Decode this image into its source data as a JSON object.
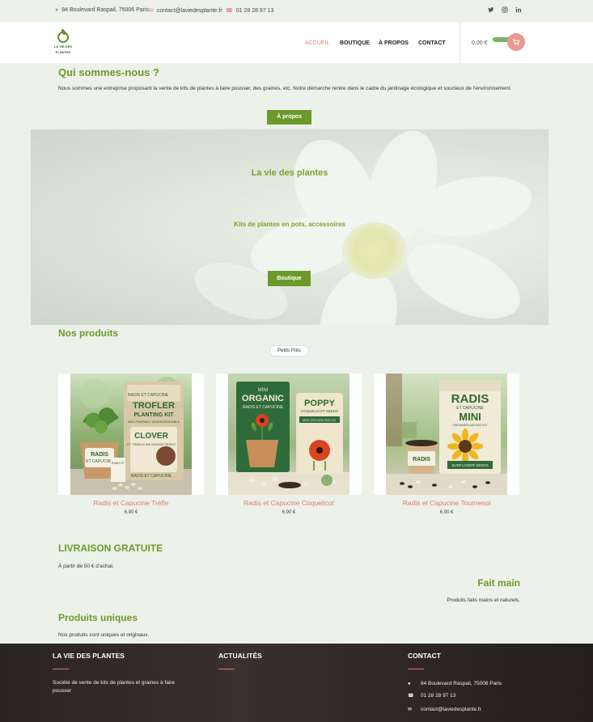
{
  "topbar": {
    "address": "84 Boulevard Raspail, 75006 Paris",
    "email": "contact@laviedesplante.fr",
    "phone": "01 28 28 97 13",
    "social": [
      "twitter-icon",
      "instagram-icon",
      "linkedin-icon"
    ]
  },
  "brand": {
    "logo_line1": "LA VIE DES",
    "logo_line2": "PLANTES"
  },
  "menu": {
    "home": "ACCUEIL",
    "shop": "BOUTIQUE",
    "about": "À PROPOS",
    "contact": "CONTACT"
  },
  "cart": {
    "total": "0,00 €"
  },
  "about": {
    "title": "Qui sommes-nous ?",
    "text": "Nous sommes une entreprise proposant la vente de kits de plantes à faire pousser, des graines, etc. Notre démarche rentre dans le cadre du jardinage écologique et soucieux de l'environnement.",
    "button": "À propos"
  },
  "hero": {
    "title": "La vie des plantes",
    "subtitle": "Kits de plantes en pots, accessoires",
    "button": "Boutique"
  },
  "products": {
    "title": "Nos produits",
    "filter": "Petits Pots",
    "items": [
      {
        "name": "Radis et Capucine Trèfle",
        "price": "6,90 €",
        "box_title": "TROFLER",
        "box_sub": "PLANTING KIT",
        "pot_label": "RADIS",
        "pack_label": "CLOVER",
        "logo": "RADIS ET CAPUCINE",
        "box_line": "MINI-FRIENDLY BIODEGRADABLE",
        "pack_line": "ET TREBUCINE RADISE SEEDS",
        "pack_foot": "RADIS ET CAPUCINE",
        "pot_sub": "ET CAPUCINE",
        "packet_small": "RADIS ET",
        "sachet": "RADIS",
        "sachet2": "ET CAPUCINE"
      },
      {
        "name": "Radis et Capucine Coquelicot",
        "price": "6,90 €",
        "box_title": "ORGANIC",
        "box_sub": "RADIS ET CAPUCINE",
        "pack_label": "POPPY",
        "box_top": "MINI",
        "pack_line": "COQUELICOT SEEDS",
        "pack_line2": "MINI ORGANIZING KIT"
      },
      {
        "name": "Radis et Capucine Tournesol",
        "price": "6,90 €",
        "box_title": "RADIS",
        "box_sub": "ET CAPUCINE",
        "box_big": "MINI",
        "pot_label": "RADIS",
        "pack_label": "SUNFLOWER SEEDS",
        "box_line": "ORGANIPLANTING KIT"
      }
    ]
  },
  "features": [
    {
      "title": "LIVRAISON GRATUITE",
      "text": "À partir de 50 € d'achat."
    },
    {
      "title": "Fait main",
      "text": "Produits faits mains et naturels."
    },
    {
      "title": "Produits uniques",
      "text": "Nos produits sont uniques et originaux."
    }
  ],
  "footer": {
    "col1_title": "LA VIE DES PLANTES",
    "col1_text": "Société de vente de kits de plantes et graines à faire pousser",
    "col2_title": "ACTUALITÉS",
    "col3_title": "CONTACT",
    "address": "84 Boulevard Raspail, 75006 Paris",
    "phone": "01 28 28 97 13",
    "email": "contact@laviedesplante.fr"
  },
  "colors": {
    "accent": "#6b9a2a",
    "highlight": "#e07a6e",
    "page_bg": "#ecf1ea",
    "footer_bg": "#2f2825"
  }
}
